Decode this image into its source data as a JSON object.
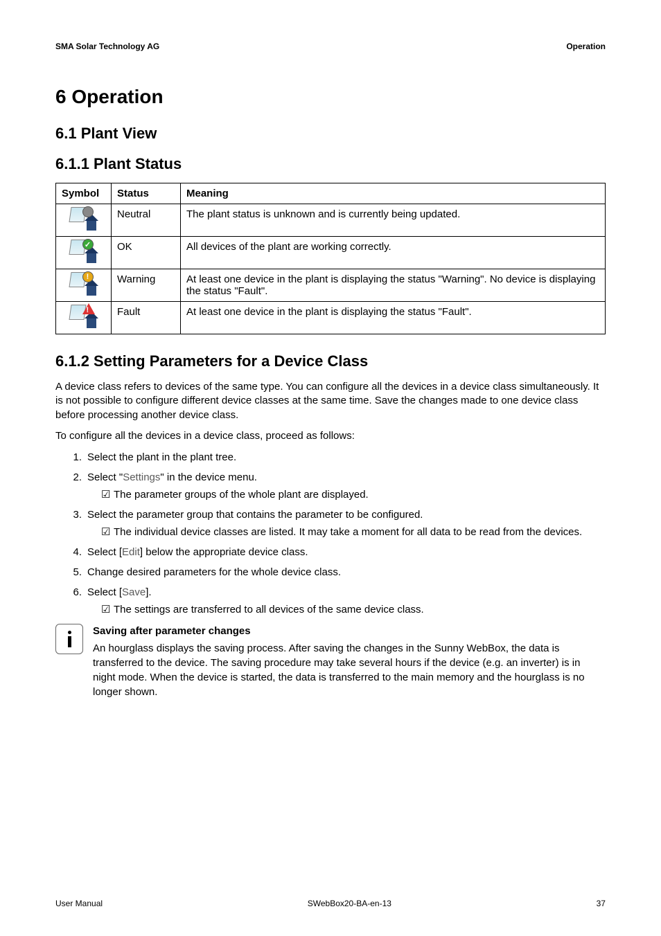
{
  "header": {
    "left": "SMA Solar Technology AG",
    "right": "Operation"
  },
  "h1": "6  Operation",
  "h2": "6.1  Plant View",
  "h3a": "6.1.1  Plant Status",
  "table": {
    "headers": {
      "symbol": "Symbol",
      "status": "Status",
      "meaning": "Meaning"
    },
    "rows": [
      {
        "status": "Neutral",
        "meaning": "The plant status is unknown and is currently being updated.",
        "icon": "neutral"
      },
      {
        "status": "OK",
        "meaning": "All devices of the plant are working correctly.",
        "icon": "ok"
      },
      {
        "status": "Warning",
        "meaning": "At least one device in the plant is displaying the status \"Warning\". No device is displaying the status \"Fault\".",
        "icon": "warning"
      },
      {
        "status": "Fault",
        "meaning": "At least one device in the plant is displaying the status \"Fault\".",
        "icon": "fault"
      }
    ]
  },
  "h3b": "6.1.2  Setting Parameters for a Device Class",
  "para1": "A device class refers to devices of the same type. You can configure all the devices in a device class simultaneously. It is not possible to configure different device classes at the same time. Save the changes made to one device class before processing another device class.",
  "para2": "To configure all the devices in a device class, proceed as follows:",
  "steps": [
    {
      "n": "1.",
      "text": "Select the plant in the plant tree."
    },
    {
      "n": "2.",
      "text_pre": "Select \"",
      "ui": "Settings",
      "text_post": "\" in the device menu.",
      "sub": "The parameter groups of the whole plant are displayed."
    },
    {
      "n": "3.",
      "text": "Select the parameter group that contains the parameter to be configured.",
      "sub": "The individual device classes are listed. It may take a moment for all data to be read from the devices."
    },
    {
      "n": "4.",
      "text_pre": "Select [",
      "ui": "Edit",
      "text_post": "] below the appropriate device class."
    },
    {
      "n": "5.",
      "text": "Change desired parameters for the whole device class."
    },
    {
      "n": "6.",
      "text_pre": "Select [",
      "ui": "Save",
      "text_post": "].",
      "sub": "The settings are transferred to all devices of the same device class."
    }
  ],
  "info": {
    "head": "Saving after parameter changes",
    "body": "An hourglass displays the saving process. After saving the changes in the Sunny WebBox, the data is transferred to the device. The saving procedure may take several hours if the device (e.g. an inverter) is in night mode. When the device is started, the data is transferred to the main memory and the hourglass is no longer shown."
  },
  "footer": {
    "left": "User Manual",
    "center": "SWebBox20-BA-en-13",
    "right": "37"
  }
}
